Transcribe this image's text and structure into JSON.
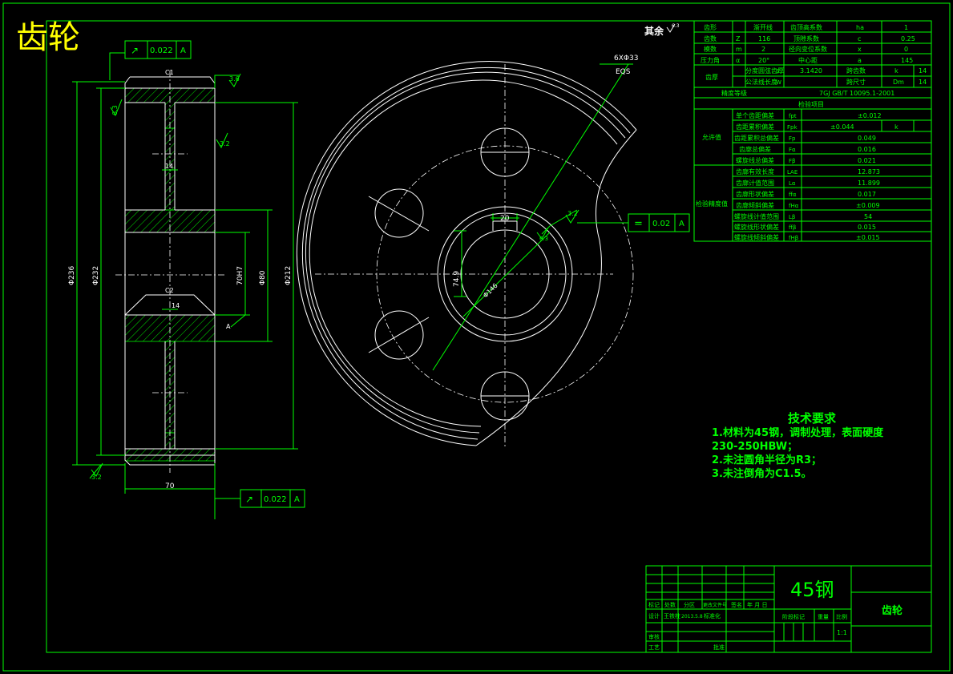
{
  "title": "齿轮",
  "surface_note": "其余",
  "surface_value": "6.3",
  "tolerance_frames": [
    {
      "symbol": "↗",
      "value": "0.022",
      "datum": "A"
    },
    {
      "symbol": "=",
      "value": "0.02",
      "datum": "A"
    },
    {
      "symbol": "↗",
      "value": "0.022",
      "datum": "A"
    }
  ],
  "section_dims": {
    "c1": "C1",
    "c2": "C2",
    "r36": "3.6",
    "r63": "6.3",
    "r32a": "3.2",
    "r32b": "3.2",
    "web14a": "14",
    "web14b": "14",
    "d236": "Φ236",
    "d232": "Φ232",
    "d212": "Φ212",
    "d80": "Φ80",
    "d70": "70H7",
    "width70": "70",
    "datumA": "A"
  },
  "front_dims": {
    "holes": "6XΦ33",
    "eqs": "EQS",
    "key20": "20",
    "r32": "3.2",
    "r63": "6.3",
    "d74": "74.9",
    "dbore": "Φ146"
  },
  "params": {
    "rows": [
      [
        "齿形",
        "",
        "渐开线",
        "齿顶高系数",
        "ha",
        "1"
      ],
      [
        "齿数",
        "Z",
        "116",
        "顶隙系数",
        "c",
        "0.25"
      ],
      [
        "模数",
        "m",
        "2",
        "径向变位系数",
        "x",
        "0"
      ],
      [
        "压力角",
        "α",
        "20°",
        "中心距",
        "a",
        "145"
      ]
    ],
    "thick_label": "齿厚",
    "thick_rows": [
      [
        "分度圆弦齿厚",
        "S",
        "3.1420",
        "跨齿数",
        "k",
        "14"
      ],
      [
        "公法线长度",
        "W",
        "",
        "跨尺寸",
        "Dm",
        "14"
      ]
    ],
    "accuracy_label": "精度等级",
    "accuracy_value": "7GJ GB/T 10095.1-2001",
    "check_header": "检验项目",
    "tolerance_group": "允许值",
    "tolerance_rows": [
      [
        "单个齿距偏差",
        "fpt",
        "±0.012",
        "",
        ""
      ],
      [
        "齿距累积偏差",
        "Fpk",
        "±0.044",
        "k",
        ""
      ],
      [
        "齿距累积总偏差",
        "Fp",
        "0.049",
        "",
        ""
      ],
      [
        "齿廓总偏差",
        "Fα",
        "0.016",
        "",
        ""
      ],
      [
        "螺旋线总偏差",
        "Fβ",
        "0.021",
        "",
        ""
      ]
    ],
    "check_group": "检验精度值",
    "check_rows": [
      [
        "齿廓有效长度",
        "LAE",
        "12.873"
      ],
      [
        "齿廓计值范围",
        "Lα",
        "11.899"
      ],
      [
        "齿廓形状偏差",
        "ffα",
        "0.017"
      ],
      [
        "齿廓倾斜偏差",
        "fHα",
        "±0.009"
      ],
      [
        "螺旋线计值范围",
        "Lβ",
        "54"
      ],
      [
        "螺旋线形状偏差",
        "ffβ",
        "0.015"
      ],
      [
        "螺旋线倾斜偏差",
        "fHβ",
        "±0.015"
      ]
    ]
  },
  "tech_req": {
    "title": "技术要求",
    "lines": [
      "1.材料为45钢，调制处理，表面硬度",
      "230-250HBW；",
      "2.未注圆角半径为R3；",
      "3.未注倒角为C1.5。"
    ]
  },
  "title_block": {
    "material": "45钢",
    "part_name": "齿轮",
    "scale": "1:1",
    "labels": {
      "mark": "标记",
      "count": "处数",
      "zone": "分区",
      "change_doc": "更改文件号",
      "sign": "签名",
      "date": "年 月 日",
      "design": "设计",
      "designer": "王铁柱",
      "design_date": "2013.5.8",
      "standard": "标准化",
      "stage_mark": "阶段标记",
      "weight": "重量",
      "ratio": "比例",
      "review": "审核",
      "process": "工艺",
      "approve": "批准"
    }
  }
}
